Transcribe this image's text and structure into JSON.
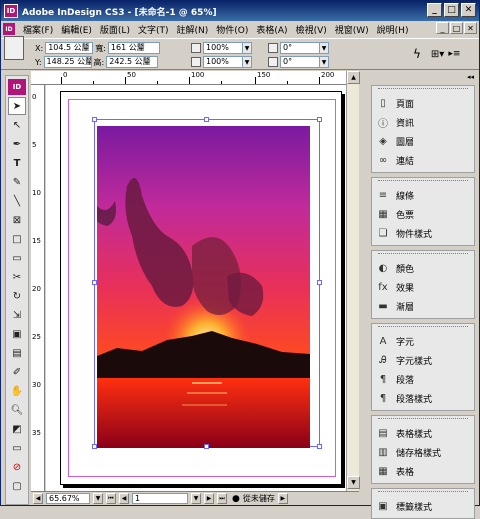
{
  "app": {
    "title": "Adobe InDesign CS3 - [未命名-1 @ 65%]",
    "icon_label": "ID"
  },
  "window_controls": {
    "minimize": "_",
    "maximize": "□",
    "close": "✕"
  },
  "menubar": {
    "items": [
      "檔案(F)",
      "編輯(E)",
      "版面(L)",
      "文字(T)",
      "註解(N)",
      "物件(O)",
      "表格(A)",
      "檢視(V)",
      "視窗(W)",
      "說明(H)"
    ]
  },
  "control_bar": {
    "x_label": "X:",
    "x_value": "104.5 公釐",
    "y_label": "Y:",
    "y_value": "148.25 公釐",
    "w_label": "寬:",
    "w_value": "161 公釐",
    "h_label": "高:",
    "h_value": "242.5 公釐",
    "scale_x_value": "100%",
    "scale_y_value": "100%",
    "rotate_value": "0°",
    "shear_value": "0°"
  },
  "ruler": {
    "top_labels": [
      "0",
      "50",
      "100",
      "150",
      "200"
    ],
    "left_labels": [
      "0",
      "5",
      "10",
      "15",
      "20",
      "25",
      "30",
      "35"
    ]
  },
  "status": {
    "zoom": "65.67%",
    "page": "1",
    "save_state": "從未儲存"
  },
  "panels": {
    "groups": [
      {
        "items": [
          {
            "icon": "page-icon",
            "glyph": "▯",
            "label": "頁面"
          },
          {
            "icon": "info-icon",
            "glyph": "ⓘ",
            "label": "資訊"
          },
          {
            "icon": "layers-icon",
            "glyph": "◈",
            "label": "圖層"
          },
          {
            "icon": "links-icon",
            "glyph": "∞",
            "label": "連結"
          }
        ]
      },
      {
        "items": [
          {
            "icon": "stroke-icon",
            "glyph": "≡",
            "label": "線條"
          },
          {
            "icon": "swatches-icon",
            "glyph": "▦",
            "label": "色票"
          },
          {
            "icon": "object-styles-icon",
            "glyph": "❏",
            "label": "物件樣式"
          }
        ]
      },
      {
        "items": [
          {
            "icon": "color-icon",
            "glyph": "◐",
            "label": "顏色"
          },
          {
            "icon": "effects-icon",
            "glyph": "fx",
            "label": "效果"
          },
          {
            "icon": "gradient-icon",
            "glyph": "▬",
            "label": "漸層"
          }
        ]
      },
      {
        "items": [
          {
            "icon": "character-icon",
            "glyph": "A",
            "label": "字元"
          },
          {
            "icon": "character-styles-icon",
            "glyph": "Ꭿ",
            "label": "字元樣式"
          },
          {
            "icon": "paragraph-icon",
            "glyph": "¶",
            "label": "段落"
          },
          {
            "icon": "paragraph-styles-icon",
            "glyph": "¶",
            "label": "段落樣式"
          }
        ]
      },
      {
        "items": [
          {
            "icon": "table-styles-icon",
            "glyph": "▤",
            "label": "表格樣式"
          },
          {
            "icon": "cell-styles-icon",
            "glyph": "▥",
            "label": "儲存格樣式"
          },
          {
            "icon": "table-icon",
            "glyph": "▦",
            "label": "表格"
          }
        ]
      },
      {
        "items": [
          {
            "icon": "tags-icon",
            "glyph": "▣",
            "label": "標籤樣式"
          }
        ]
      }
    ]
  },
  "colors": {
    "title_bar": "#0a246a",
    "brand": "#b0167a",
    "frame_stroke": "#6a6aff",
    "margin_guide": "#d060d0"
  }
}
